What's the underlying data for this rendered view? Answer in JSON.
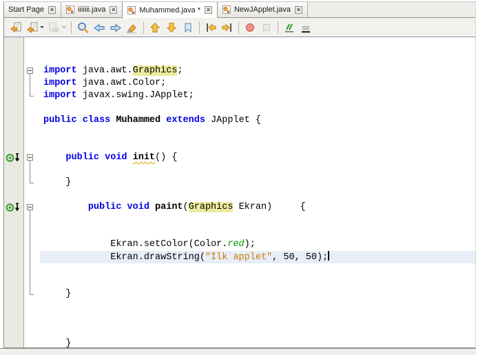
{
  "tabs": {
    "close_glyph": "×",
    "items": [
      {
        "label": "Start Page",
        "icon": null,
        "active": false
      },
      {
        "label": "iiiiiii.java",
        "icon": "java-class-icon",
        "active": false
      },
      {
        "label": "Muhammed.java *",
        "icon": "java-class-icon",
        "active": true
      },
      {
        "label": "NewJApplet.java",
        "icon": "java-class-icon",
        "active": false
      }
    ]
  },
  "toolbar": {
    "buttons": [
      {
        "name": "last-edit-location",
        "icon": "doc-arrow-icon",
        "enabled": true,
        "dropdown": false
      },
      {
        "name": "back",
        "icon": "back-icon",
        "enabled": true,
        "dropdown": true
      },
      {
        "name": "forward",
        "icon": "forward-icon",
        "enabled": false,
        "dropdown": true
      },
      {
        "separator": true
      },
      {
        "name": "find-selection",
        "icon": "magnifier-icon",
        "enabled": true,
        "dropdown": false
      },
      {
        "name": "find-previous-occurrence",
        "icon": "arrow-left-icon",
        "enabled": true,
        "dropdown": false
      },
      {
        "name": "find-next-occurrence",
        "icon": "arrow-right-icon",
        "enabled": true,
        "dropdown": false
      },
      {
        "name": "toggle-highlight-search",
        "icon": "highlighter-icon",
        "enabled": true,
        "dropdown": false
      },
      {
        "separator": true
      },
      {
        "name": "previous-bookmark",
        "icon": "bookmark-up-icon",
        "enabled": true,
        "dropdown": false
      },
      {
        "name": "next-bookmark",
        "icon": "bookmark-down-icon",
        "enabled": true,
        "dropdown": false
      },
      {
        "name": "toggle-bookmark",
        "icon": "bookmark-icon",
        "enabled": true,
        "dropdown": false
      },
      {
        "separator": true
      },
      {
        "name": "shift-line-left",
        "icon": "shift-left-icon",
        "enabled": true,
        "dropdown": false
      },
      {
        "name": "shift-line-right",
        "icon": "shift-right-icon",
        "enabled": true,
        "dropdown": false
      },
      {
        "separator": true
      },
      {
        "name": "start-macro-recording",
        "icon": "record-icon",
        "enabled": true,
        "dropdown": false
      },
      {
        "name": "stop-macro-recording",
        "icon": "stop-icon",
        "enabled": false,
        "dropdown": false
      },
      {
        "separator": true
      },
      {
        "name": "comment",
        "icon": "comment-icon",
        "enabled": true,
        "dropdown": false
      },
      {
        "name": "uncomment",
        "icon": "uncomment-icon",
        "enabled": true,
        "dropdown": false
      }
    ]
  },
  "editor": {
    "caret_line": 18,
    "annotations": [
      {
        "line": 10,
        "type": "override-icon"
      },
      {
        "line": 14,
        "type": "override-icon"
      }
    ],
    "folds": [
      {
        "from": 3,
        "to": 5
      },
      {
        "from": 10,
        "to": 12
      },
      {
        "from": 14,
        "to": 21
      }
    ],
    "lines": [
      {
        "segments": []
      },
      {
        "segments": []
      },
      {
        "segments": [
          {
            "t": "import ",
            "k": "keyword"
          },
          {
            "t": "java.awt.",
            "k": "plain"
          },
          {
            "t": "Graphics",
            "k": "plain",
            "occ": true
          },
          {
            "t": ";",
            "k": "plain"
          }
        ]
      },
      {
        "segments": [
          {
            "t": "import ",
            "k": "keyword"
          },
          {
            "t": "java.awt.Color;",
            "k": "plain"
          }
        ]
      },
      {
        "segments": [
          {
            "t": "import ",
            "k": "keyword"
          },
          {
            "t": "javax.swing.JApplet;",
            "k": "plain"
          }
        ]
      },
      {
        "segments": []
      },
      {
        "segments": [
          {
            "t": "public class ",
            "k": "keyword"
          },
          {
            "t": "Muhammed",
            "k": "name"
          },
          {
            "t": " ",
            "k": "plain"
          },
          {
            "t": "extends",
            "k": "keyword"
          },
          {
            "t": " JApplet {",
            "k": "plain"
          }
        ]
      },
      {
        "segments": []
      },
      {
        "segments": []
      },
      {
        "segments": [
          {
            "t": "    ",
            "k": "plain"
          },
          {
            "t": "public void ",
            "k": "keyword"
          },
          {
            "t": "init",
            "k": "name",
            "warn": true
          },
          {
            "t": "() {",
            "k": "plain"
          }
        ]
      },
      {
        "segments": []
      },
      {
        "segments": [
          {
            "t": "    }",
            "k": "plain"
          }
        ]
      },
      {
        "segments": []
      },
      {
        "segments": [
          {
            "t": "        ",
            "k": "plain"
          },
          {
            "t": "public void ",
            "k": "keyword"
          },
          {
            "t": "paint",
            "k": "name"
          },
          {
            "t": "(",
            "k": "plain"
          },
          {
            "t": "Graphics",
            "k": "plain",
            "occ": true
          },
          {
            "t": " Ekran)     {",
            "k": "plain"
          }
        ]
      },
      {
        "segments": []
      },
      {
        "segments": []
      },
      {
        "segments": [
          {
            "t": "            Ekran.setColor(Color.",
            "k": "plain"
          },
          {
            "t": "red",
            "k": "field"
          },
          {
            "t": ");",
            "k": "plain"
          }
        ]
      },
      {
        "segments": [
          {
            "t": "            Ekran.drawString(",
            "k": "plain"
          },
          {
            "t": "\"İlk applet\"",
            "k": "string"
          },
          {
            "t": ", 50, 50);",
            "k": "plain"
          }
        ],
        "current": true,
        "caret": true
      },
      {
        "segments": []
      },
      {
        "segments": []
      },
      {
        "segments": [
          {
            "t": "    }",
            "k": "plain"
          }
        ]
      },
      {
        "segments": []
      },
      {
        "segments": []
      },
      {
        "segments": []
      },
      {
        "segments": [
          {
            "t": "    }",
            "k": "plain"
          }
        ]
      }
    ]
  },
  "colors": {
    "keyword": "#0000e6",
    "string": "#ce7b00",
    "static_field": "#009900",
    "occurrence_bg": "#eceb9d",
    "current_line_bg": "#e7eef7",
    "warn_underline": "#e0a000",
    "gutter_bg": "#e9e8e1"
  }
}
